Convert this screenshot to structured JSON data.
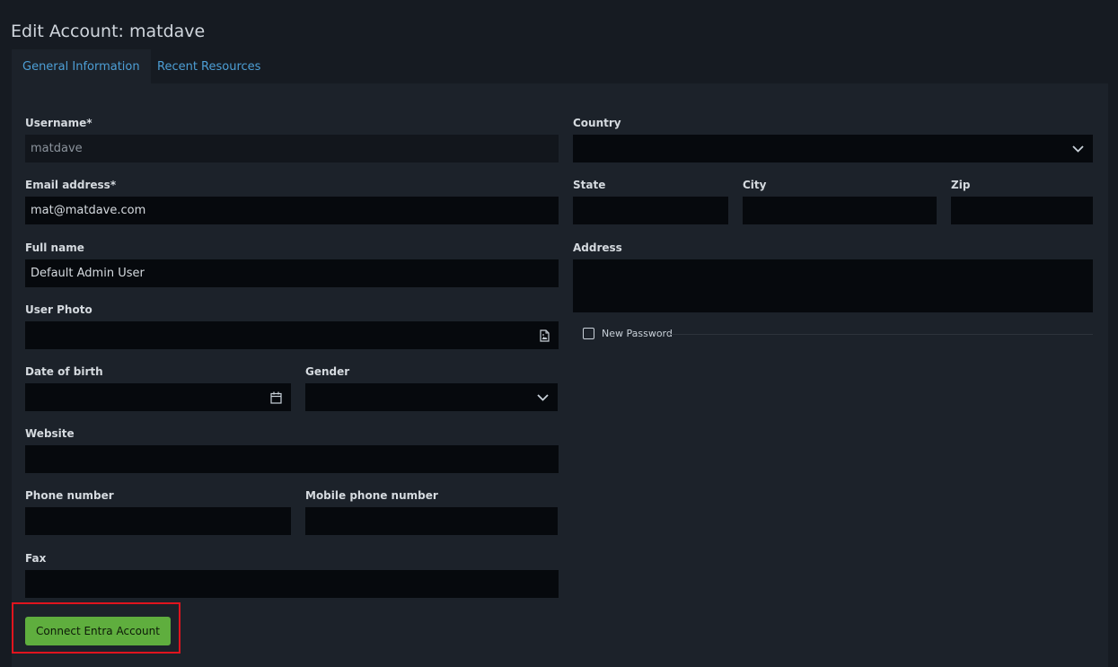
{
  "page": {
    "title": "Edit Account: matdave"
  },
  "tabs": [
    {
      "label": "General Information",
      "active": true
    },
    {
      "label": "Recent Resources",
      "active": false
    }
  ],
  "form": {
    "username": {
      "label": "Username*",
      "value": "matdave"
    },
    "email": {
      "label": "Email address*",
      "value": "mat@matdave.com"
    },
    "fullname": {
      "label": "Full name",
      "value": "Default Admin User"
    },
    "photo": {
      "label": "User Photo",
      "value": "",
      "icon": "file-image-icon"
    },
    "dob": {
      "label": "Date of birth",
      "value": "",
      "icon": "calendar-icon"
    },
    "gender": {
      "label": "Gender",
      "value": "",
      "icon": "chevron-down-icon"
    },
    "website": {
      "label": "Website",
      "value": ""
    },
    "phone": {
      "label": "Phone number",
      "value": ""
    },
    "mobile": {
      "label": "Mobile phone number",
      "value": ""
    },
    "fax": {
      "label": "Fax",
      "value": ""
    },
    "country": {
      "label": "Country",
      "value": "",
      "icon": "chevron-down-icon"
    },
    "state": {
      "label": "State",
      "value": ""
    },
    "city": {
      "label": "City",
      "value": ""
    },
    "zip": {
      "label": "Zip",
      "value": ""
    },
    "address": {
      "label": "Address",
      "value": ""
    },
    "new_password": {
      "label": "New Password",
      "checked": false
    }
  },
  "actions": {
    "connect_label": "Connect Entra Account"
  },
  "colors": {
    "background": "#161b22",
    "panel": "#1c222a",
    "input": "#06090d",
    "tab_link": "#4d9fd6",
    "connect_button": "#5fae3e",
    "highlight": "#e0141e"
  }
}
